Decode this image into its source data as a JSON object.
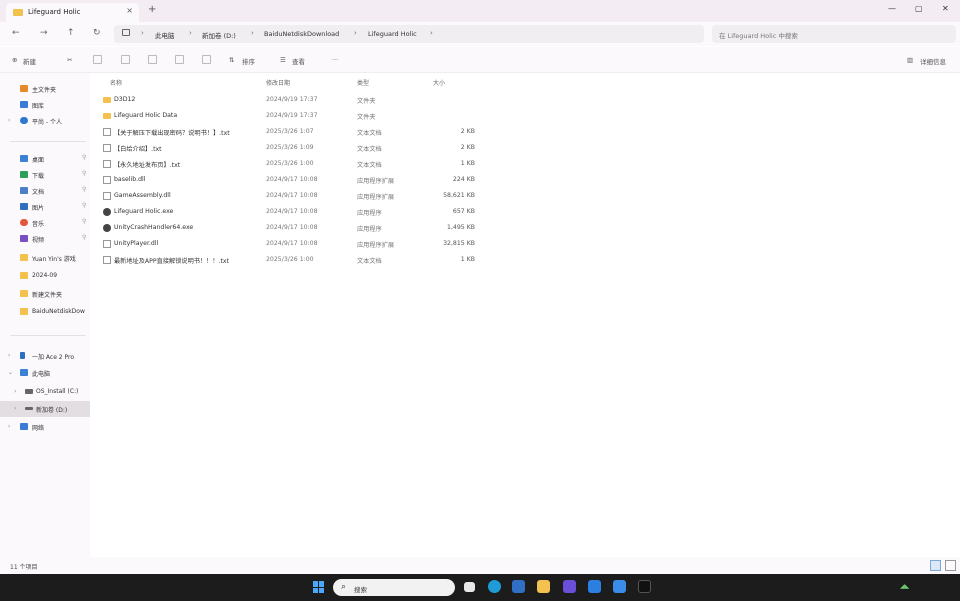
{
  "window": {
    "tab_title": "Lifeguard Holic",
    "new_tab_label": "+",
    "close_tab": "×",
    "minimize": "—",
    "maximize": "▢",
    "close": "✕"
  },
  "address": {
    "back": "←",
    "forward": "→",
    "up": "↑",
    "refresh": "↻",
    "crumbs": [
      "此电脑",
      "新加卷 (D:)",
      "BaiduNetdiskDownload",
      "Lifeguard Holic"
    ],
    "search_placeholder": "在 Lifeguard Holic 中搜索"
  },
  "toolbar": {
    "new_label": "新建",
    "sort_label": "排序",
    "view_label": "查看",
    "more_label": "···",
    "details_label": "详细信息"
  },
  "sidebar": {
    "items": [
      {
        "label": "主文件夹",
        "icon": "home-icon"
      },
      {
        "label": "图库",
        "icon": "gallery-icon"
      },
      {
        "label": "平尚 - 个人",
        "icon": "cloud-icon"
      },
      {
        "label": "桌面",
        "icon": "desktop-icon"
      },
      {
        "label": "下载",
        "icon": "download-icon"
      },
      {
        "label": "文档",
        "icon": "document-icon"
      },
      {
        "label": "图片",
        "icon": "pictures-icon"
      },
      {
        "label": "音乐",
        "icon": "music-icon"
      },
      {
        "label": "视频",
        "icon": "video-icon"
      },
      {
        "label": "Yuan Yin's 游戏",
        "icon": "folder-icon"
      },
      {
        "label": "2024-09",
        "icon": "folder-icon"
      },
      {
        "label": "新建文件夹",
        "icon": "folder-icon"
      },
      {
        "label": "BaiduNetdiskDow",
        "icon": "folder-icon"
      },
      {
        "label": "一加 Ace 2 Pro",
        "icon": "phone-icon"
      },
      {
        "label": "此电脑",
        "icon": "pc-icon"
      },
      {
        "label": "OS_Install (C:)",
        "icon": "drive-icon"
      },
      {
        "label": "新加卷 (D:)",
        "icon": "drive-icon"
      },
      {
        "label": "网络",
        "icon": "network-icon"
      }
    ]
  },
  "columns": {
    "name": "名称",
    "date": "修改日期",
    "type": "类型",
    "size": "大小"
  },
  "files": [
    {
      "name": "D3D12",
      "date": "2024/9/19 17:37",
      "type": "文件夹",
      "size": "",
      "icon": "folder"
    },
    {
      "name": "Lifeguard Holic Data",
      "date": "2024/9/19 17:37",
      "type": "文件夹",
      "size": "",
      "icon": "folder"
    },
    {
      "name": "【关于解压下载出现密码？说明书！】.txt",
      "date": "2025/3/26 1:07",
      "type": "文本文档",
      "size": "2 KB",
      "icon": "txt"
    },
    {
      "name": "【白给介绍】.txt",
      "date": "2025/3/26 1:09",
      "type": "文本文档",
      "size": "2 KB",
      "icon": "txt"
    },
    {
      "name": "【永久地址发布页】.txt",
      "date": "2025/3/26 1:00",
      "type": "文本文档",
      "size": "1 KB",
      "icon": "txt"
    },
    {
      "name": "baselib.dll",
      "date": "2024/9/17 10:08",
      "type": "应用程序扩展",
      "size": "224 KB",
      "icon": "dll"
    },
    {
      "name": "GameAssembly.dll",
      "date": "2024/9/17 10:08",
      "type": "应用程序扩展",
      "size": "58,621 KB",
      "icon": "dll"
    },
    {
      "name": "Lifeguard Holic.exe",
      "date": "2024/9/17 10:08",
      "type": "应用程序",
      "size": "657 KB",
      "icon": "exe"
    },
    {
      "name": "UnityCrashHandler64.exe",
      "date": "2024/9/17 10:08",
      "type": "应用程序",
      "size": "1,495 KB",
      "icon": "exe"
    },
    {
      "name": "UnityPlayer.dll",
      "date": "2024/9/17 10:08",
      "type": "应用程序扩展",
      "size": "32,815 KB",
      "icon": "dll"
    },
    {
      "name": "最新地址及APP直接解锁说明书！！！.txt",
      "date": "2025/3/26 1:00",
      "type": "文本文档",
      "size": "1 KB",
      "icon": "txt"
    }
  ],
  "status": {
    "count": "11 个项目"
  },
  "taskbar": {
    "search_label": "搜索",
    "search_icon": "⌕",
    "tray": "◢◣"
  }
}
